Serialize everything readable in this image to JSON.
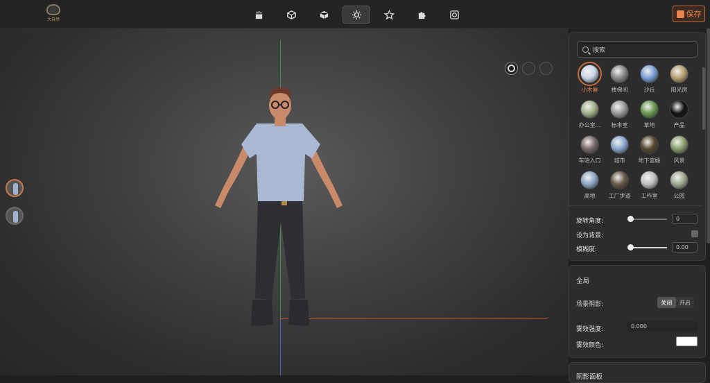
{
  "app": {
    "logo_text": "大自然"
  },
  "toolbar": {
    "tools": [
      {
        "name": "scene-icon"
      },
      {
        "name": "model-icon"
      },
      {
        "name": "cube-icon"
      },
      {
        "name": "lighting-icon"
      },
      {
        "name": "star-icon"
      },
      {
        "name": "puzzle-icon"
      },
      {
        "name": "camera-icon"
      }
    ],
    "active_tool": "lighting-icon",
    "save_label": "保存"
  },
  "environment": {
    "search_placeholder": "搜索",
    "items": [
      {
        "label": "小木屋",
        "color": "#c9d6e8"
      },
      {
        "label": "楼梯间",
        "color": "#8a8a8a"
      },
      {
        "label": "沙丘",
        "color": "#7aa0d8"
      },
      {
        "label": "阳光房",
        "color": "#b8a070"
      },
      {
        "label": "办公室...",
        "color": "#a0b08a"
      },
      {
        "label": "标本室",
        "color": "#9a9a9a"
      },
      {
        "label": "草地",
        "color": "#6a9a50"
      },
      {
        "label": "产品",
        "color": "#111111"
      },
      {
        "label": "车站入口",
        "color": "#7a6a6a"
      },
      {
        "label": "城市",
        "color": "#8aa8d0"
      },
      {
        "label": "地下宫殿",
        "color": "#5a4a30"
      },
      {
        "label": "风景",
        "color": "#8aa070"
      },
      {
        "label": "高地",
        "color": "#90a8c8"
      },
      {
        "label": "工厂步道",
        "color": "#6a5a4a"
      },
      {
        "label": "工作室",
        "color": "#c0c0c0"
      },
      {
        "label": "公园",
        "color": "#a0a890"
      }
    ],
    "selected": 0,
    "rotation_label": "旋转角度:",
    "rotation_value": "0",
    "background_label": "设为背景:",
    "blur_label": "模糊度:",
    "blur_value": "0.00"
  },
  "global": {
    "title": "全局",
    "shadow_label": "场景阴影:",
    "shadow_off": "关闭",
    "shadow_on": "开启",
    "fog_strength_label": "雾效强度:",
    "fog_strength_value": "0.000",
    "fog_color_label": "雾效颜色:",
    "fog_color": "#ffffff"
  },
  "next_section_title": "阴影面板"
}
